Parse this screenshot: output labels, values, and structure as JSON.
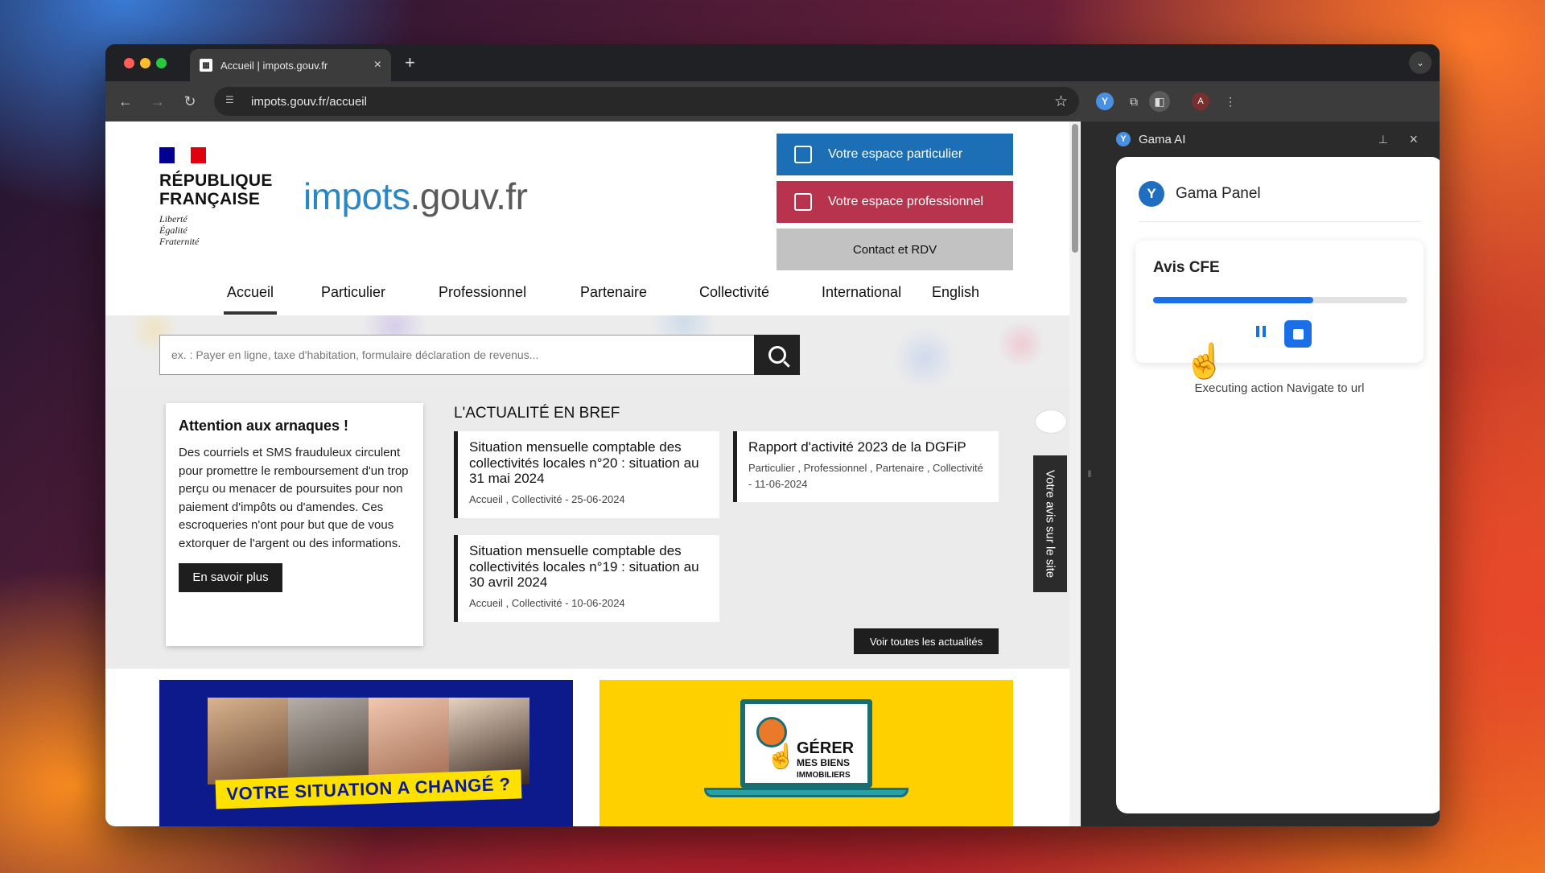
{
  "browser": {
    "tab_title": "Accueil | impots.gouv.fr",
    "url": "impots.gouv.fr/accueil",
    "profile_initial": "A"
  },
  "site": {
    "gov_name_line1": "RÉPUBLIQUE",
    "gov_name_line2": "FRANÇAISE",
    "motto": [
      "Liberté",
      "Égalité",
      "Fraternité"
    ],
    "logo_main": "impots",
    "logo_tld": ".gouv.fr",
    "buttons": {
      "particulier": "Votre espace particulier",
      "professionnel": "Votre espace professionnel",
      "contact": "Contact et RDV"
    },
    "nav": [
      "Accueil",
      "Particulier",
      "Professionnel",
      "Partenaire",
      "Collectivité",
      "International",
      "English"
    ],
    "search_placeholder": "ex. : Payer en ligne, taxe d'habitation, formulaire déclaration de revenus...",
    "alert": {
      "title": "Attention aux arnaques !",
      "body": "Des courriels et SMS frauduleux circulent pour promettre le remboursement d'un trop perçu ou menacer de poursuites pour non paiement d'impôts ou d'amendes. Ces escroqueries n'ont pour but que de vous extorquer de l'argent ou des informations.",
      "button": "En savoir plus"
    },
    "news": {
      "heading": "L'ACTUALITÉ EN BREF",
      "items": [
        {
          "title": "Situation mensuelle comptable des collectivités locales n°20 : situation au 31 mai 2024",
          "meta": "Accueil , Collectivité - 25-06-2024"
        },
        {
          "title": "Rapport d'activité 2023 de la DGFiP",
          "meta": "Particulier , Professionnel , Partenaire , Collectivité - 11-06-2024"
        },
        {
          "title": "Situation mensuelle comptable des collectivités locales n°19 : situation au 30 avril 2024",
          "meta": "Accueil , Collectivité - 10-06-2024"
        }
      ],
      "all_button": "Voir toutes les actualités"
    },
    "feedback_tab": "Votre avis sur le site",
    "banner1_text": "VOTRE SITUATION A CHANGÉ ?",
    "banner2_lines": [
      "GÉRER",
      "MES BIENS",
      "IMMOBILIERS"
    ]
  },
  "side_panel": {
    "title": "Gama AI",
    "panel_title": "Gama Panel",
    "task_title": "Avis CFE",
    "progress_pct": 63,
    "status": "Executing action Navigate to url"
  },
  "colors": {
    "particulier_btn": "#1d6fb5",
    "professionnel_btn": "#b8334d",
    "contact_btn": "#c2c2c2",
    "flag_blue": "#000091",
    "flag_red": "#e1000f",
    "accent_blue": "#1a6ee6"
  }
}
